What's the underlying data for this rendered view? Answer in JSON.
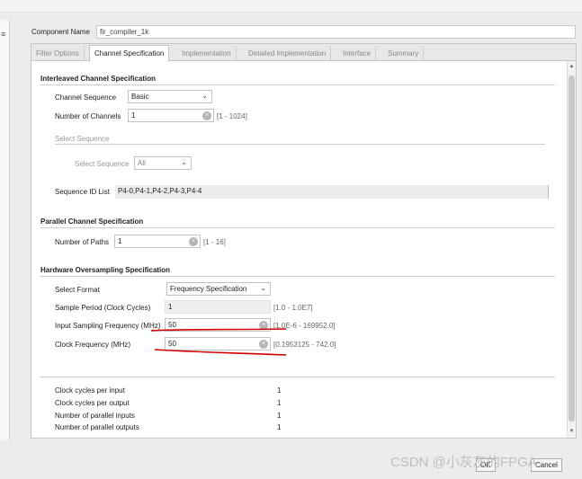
{
  "component_name": {
    "label": "Component Name",
    "value": "fir_compiler_1k"
  },
  "tabs": [
    {
      "label": "Filter Options"
    },
    {
      "label": "Channel Specification"
    },
    {
      "label": "Implementation"
    },
    {
      "label": "Detailed Implementation"
    },
    {
      "label": "Interface"
    },
    {
      "label": "Summary"
    }
  ],
  "interleaved": {
    "title": "Interleaved Channel Specification",
    "channel_sequence_label": "Channel Sequence",
    "channel_sequence_value": "Basic",
    "num_channels_label": "Number of Channels",
    "num_channels_value": "1",
    "num_channels_range": "[1 - 1024]",
    "select_sequence_title": "Select Sequence",
    "select_sequence_label": "Select Sequence",
    "select_sequence_value": "All",
    "sequence_id_label": "Sequence ID List",
    "sequence_id_value": "P4-0,P4-1,P4-2,P4-3,P4-4"
  },
  "parallel": {
    "title": "Parallel Channel Specification",
    "num_paths_label": "Number of Paths",
    "num_paths_value": "1",
    "num_paths_range": "[1 - 16]"
  },
  "oversampling": {
    "title": "Hardware Oversampling Specification",
    "select_format_label": "Select Format",
    "select_format_value": "Frequency Specification",
    "sample_period_label": "Sample Period (Clock Cycles)",
    "sample_period_value": "1",
    "sample_period_range": "[1.0 - 1.0E7]",
    "input_freq_label": "Input Sampling Frequency (MHz)",
    "input_freq_value": "50",
    "input_freq_range": "[1.0E-6 - 169952.0]",
    "clock_freq_label": "Clock Frequency (MHz)",
    "clock_freq_value": "50",
    "clock_freq_range": "[0.1953125 - 742.0]"
  },
  "summary": [
    {
      "label": "Clock cycles per input",
      "value": "1"
    },
    {
      "label": "Clock cycles per output",
      "value": "1"
    },
    {
      "label": "Number of parallel inputs",
      "value": "1"
    },
    {
      "label": "Number of parallel outputs",
      "value": "1"
    }
  ],
  "buttons": {
    "ok": "OK",
    "cancel": "Cancel"
  },
  "watermark": "CSDN @小灰灰的FPGA",
  "colors": {
    "annotation": "#d40000",
    "panel_bg": "#ffffff",
    "window_bg": "#ececec"
  }
}
